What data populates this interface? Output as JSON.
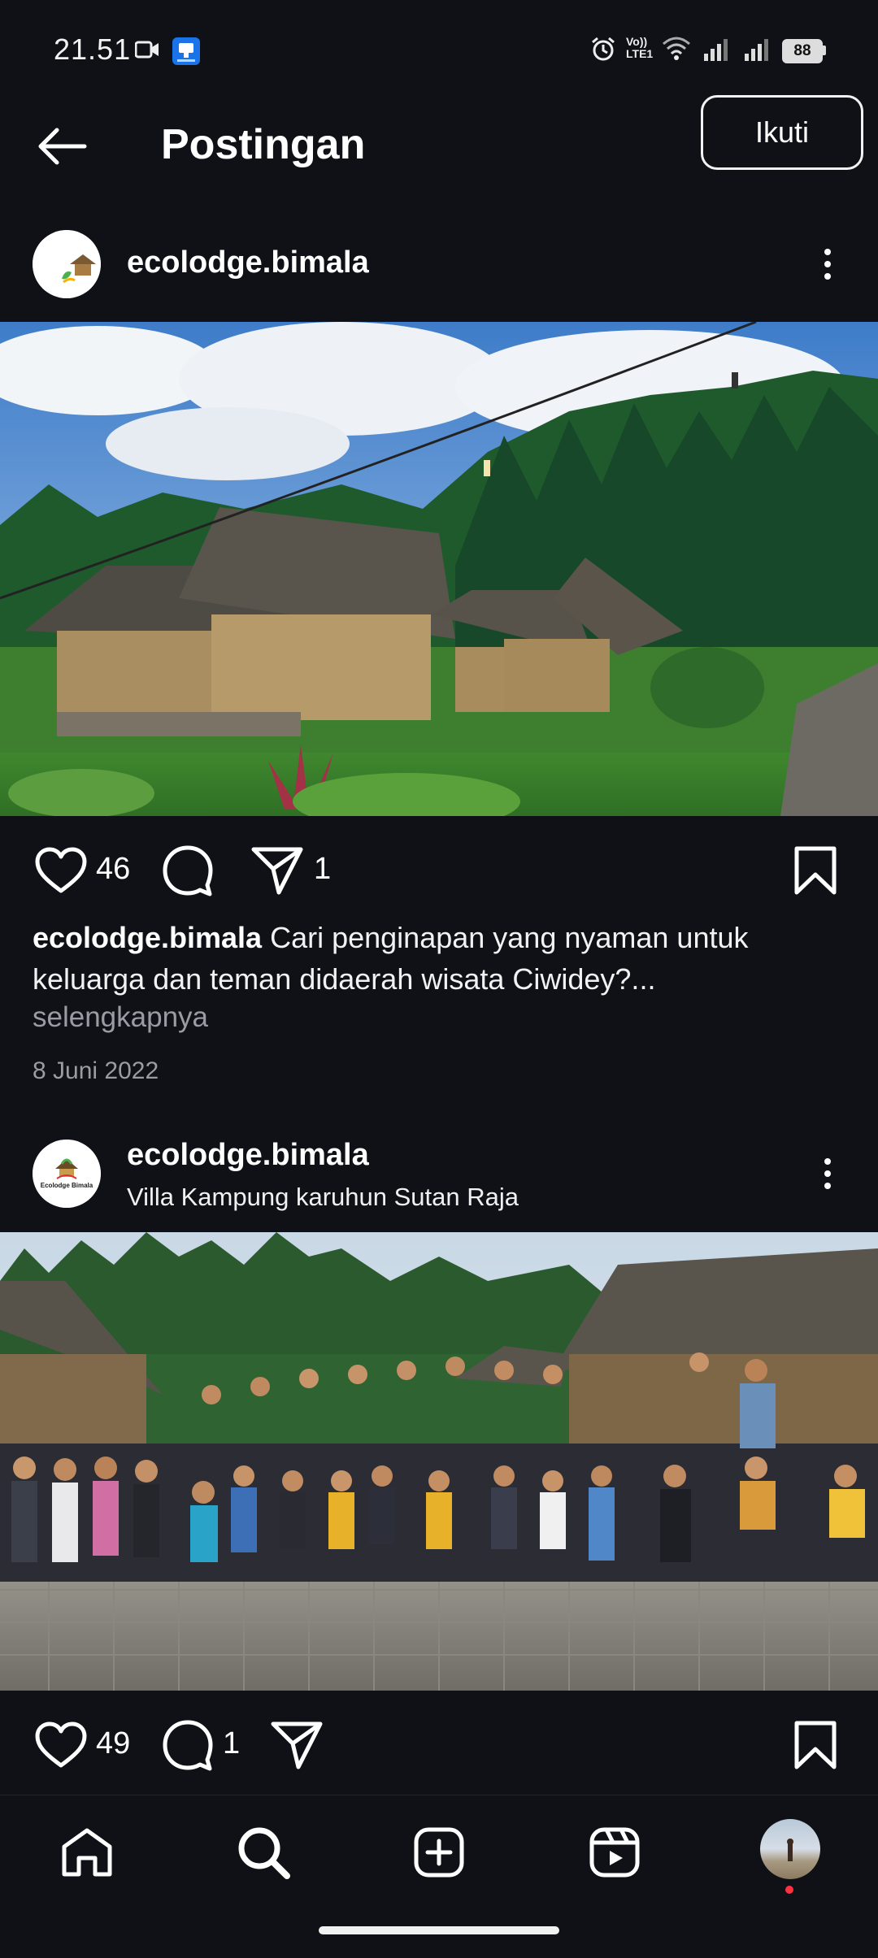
{
  "status_bar": {
    "time": "21.51",
    "battery": "88",
    "volte_label_top": "Vo))",
    "volte_label_bottom": "LTE1"
  },
  "header": {
    "title": "Postingan",
    "follow_label": "Ikuti"
  },
  "post1": {
    "username": "ecolodge.bimala",
    "likes": "46",
    "shares": "1",
    "caption_user": "ecolodge.bimala",
    "caption_text": " Cari penginapan yang nyaman untuk keluarga dan teman didaerah wisata Ciwidey?...",
    "more_link": "selengkapnya",
    "date": "8 Juni 2022"
  },
  "post2": {
    "username": "ecolodge.bimala",
    "location": "Villa Kampung karuhun Sutan Raja",
    "avatar_logo_text": "Ecolodge Bimala",
    "likes": "49",
    "comments": "1"
  },
  "icons": {
    "back": "arrow-left-icon",
    "like": "heart-icon",
    "comment": "comment-bubble-icon",
    "share": "paper-plane-icon",
    "save": "bookmark-icon",
    "more": "more-vertical-icon",
    "nav_home": "home-icon",
    "nav_search": "search-icon",
    "nav_create": "plus-square-icon",
    "nav_reels": "reels-icon"
  },
  "colors": {
    "background": "#0f1117",
    "text": "#ffffff",
    "muted": "#9a9ca3",
    "notification_dot": "#ff3040"
  }
}
